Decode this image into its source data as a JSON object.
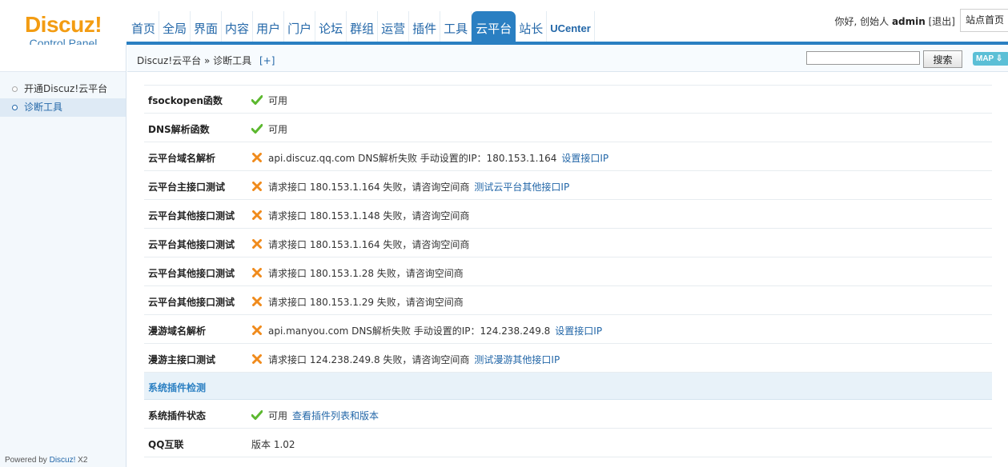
{
  "logo": {
    "main": "Discuz!",
    "sub": "Control Panel"
  },
  "nav": {
    "tabs": [
      {
        "label": "首页"
      },
      {
        "label": "全局"
      },
      {
        "label": "界面"
      },
      {
        "label": "内容"
      },
      {
        "label": "用户"
      },
      {
        "label": "门户"
      },
      {
        "label": "论坛"
      },
      {
        "label": "群组"
      },
      {
        "label": "运营"
      },
      {
        "label": "插件"
      },
      {
        "label": "工具"
      },
      {
        "label": "云平台",
        "active": true
      },
      {
        "label": "站长"
      },
      {
        "label": "UCenter"
      }
    ]
  },
  "user": {
    "greeting": "你好, 创始人",
    "name": "admin",
    "logout": "[退出]",
    "home": "站点首页"
  },
  "breadcrumb": {
    "text": "Discuz!云平台 » 诊断工具",
    "add": "[+]"
  },
  "search": {
    "value": "",
    "button": "搜索",
    "map": "MAP ⇩"
  },
  "sidebar": {
    "items": [
      {
        "label": "开通Discuz!云平台",
        "active": false
      },
      {
        "label": "诊断工具",
        "active": true
      }
    ],
    "powered_prefix": "Powered by",
    "powered_link": "Discuz!",
    "powered_suffix": "X2"
  },
  "rows": [
    {
      "label": "fsockopen函数",
      "status": "ok",
      "text": "可用"
    },
    {
      "label": "DNS解析函数",
      "status": "ok",
      "text": "可用"
    },
    {
      "label": "云平台域名解析",
      "status": "fail",
      "text": "api.discuz.qq.com DNS解析失败  手动设置的IP：180.153.1.164",
      "link": "设置接口IP"
    },
    {
      "label": "云平台主接口测试",
      "status": "fail",
      "text": "请求接口  180.153.1.164 失败，请咨询空间商",
      "link": "测试云平台其他接口IP"
    },
    {
      "label": "云平台其他接口测试",
      "status": "fail",
      "text": "请求接口  180.153.1.148 失败，请咨询空间商"
    },
    {
      "label": "云平台其他接口测试",
      "status": "fail",
      "text": "请求接口  180.153.1.164 失败，请咨询空间商"
    },
    {
      "label": "云平台其他接口测试",
      "status": "fail",
      "text": "请求接口  180.153.1.28 失败，请咨询空间商"
    },
    {
      "label": "云平台其他接口测试",
      "status": "fail",
      "text": "请求接口  180.153.1.29 失败，请咨询空间商"
    },
    {
      "label": "漫游域名解析",
      "status": "fail",
      "text": "api.manyou.com DNS解析失败  手动设置的IP：124.238.249.8",
      "link": "设置接口IP"
    },
    {
      "label": "漫游主接口测试",
      "status": "fail",
      "text": "请求接口  124.238.249.8 失败，请咨询空间商",
      "link": "测试漫游其他接口IP"
    }
  ],
  "section": {
    "title": "系统插件检测"
  },
  "rows2": [
    {
      "label": "系统插件状态",
      "status": "ok",
      "text": "可用",
      "link": "查看插件列表和版本"
    },
    {
      "label": "QQ互联",
      "status": "none",
      "text": "版本  1.02"
    }
  ],
  "colors": {
    "accent": "#2a7fc2",
    "ok": "#5cb82f",
    "fail": "#f08b1c",
    "link": "#2367a8"
  }
}
